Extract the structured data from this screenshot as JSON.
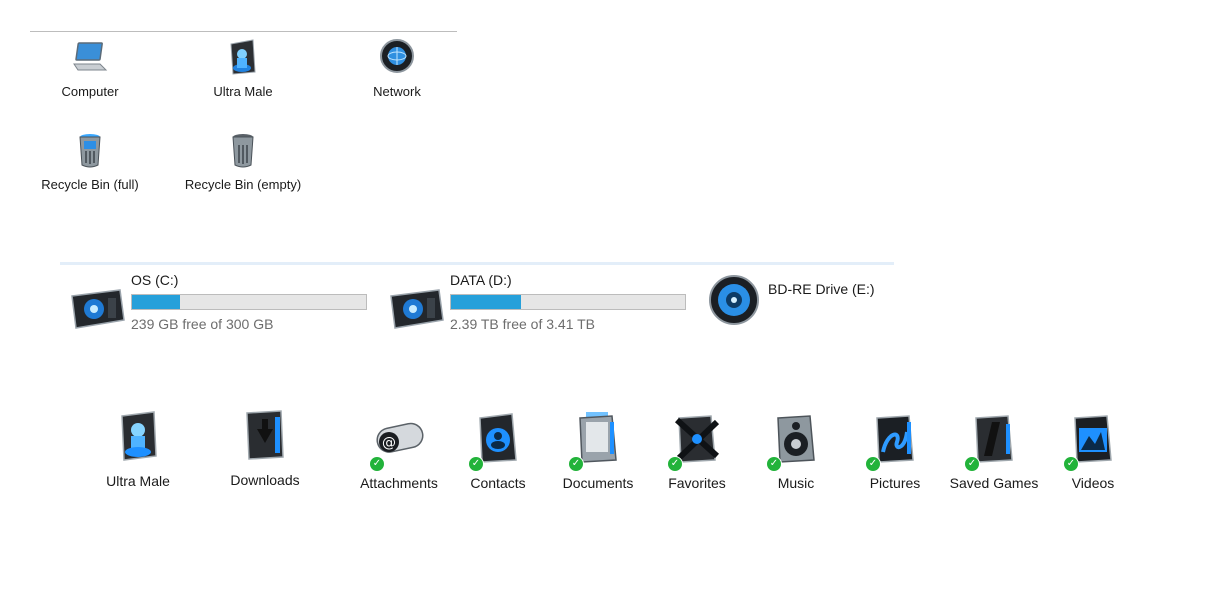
{
  "desktop_icons": [
    {
      "label": "Computer",
      "icon": "laptop-icon"
    },
    {
      "label": "Ultra Male",
      "icon": "user-folder-icon"
    },
    {
      "label": "Network",
      "icon": "network-globe-icon"
    },
    {
      "label": "Recycle Bin (full)",
      "icon": "recycle-bin-full-icon"
    },
    {
      "label": "Recycle Bin (empty)",
      "icon": "recycle-bin-empty-icon"
    }
  ],
  "drives": [
    {
      "name": "OS (C:)",
      "free_text": "239 GB free of 300 GB",
      "used_fraction": 0.203,
      "icon": "hard-drive-icon"
    },
    {
      "name": "DATA (D:)",
      "free_text": "2.39 TB free of 3.41 TB",
      "used_fraction": 0.299,
      "icon": "hard-drive-icon"
    },
    {
      "name": "BD-RE Drive (E:)",
      "icon": "optical-drive-icon"
    }
  ],
  "libraries": [
    {
      "label": "Ultra Male",
      "icon": "user-folder-icon",
      "synced": false
    },
    {
      "label": "Downloads",
      "icon": "downloads-folder-icon",
      "synced": false
    },
    {
      "label": "Attachments",
      "icon": "attachments-icon",
      "synced": true
    },
    {
      "label": "Contacts",
      "icon": "contacts-folder-icon",
      "synced": true
    },
    {
      "label": "Documents",
      "icon": "documents-folder-icon",
      "synced": true
    },
    {
      "label": "Favorites",
      "icon": "favorites-folder-icon",
      "synced": true
    },
    {
      "label": "Music",
      "icon": "music-folder-icon",
      "synced": true
    },
    {
      "label": "Pictures",
      "icon": "pictures-folder-icon",
      "synced": true
    },
    {
      "label": "Saved Games",
      "icon": "saved-games-folder-icon",
      "synced": true
    },
    {
      "label": "Videos",
      "icon": "videos-folder-icon",
      "synced": true
    }
  ],
  "colors": {
    "accent": "#26a0da",
    "sync_check": "#22b33a",
    "icon_blue": "#1e90ff"
  }
}
